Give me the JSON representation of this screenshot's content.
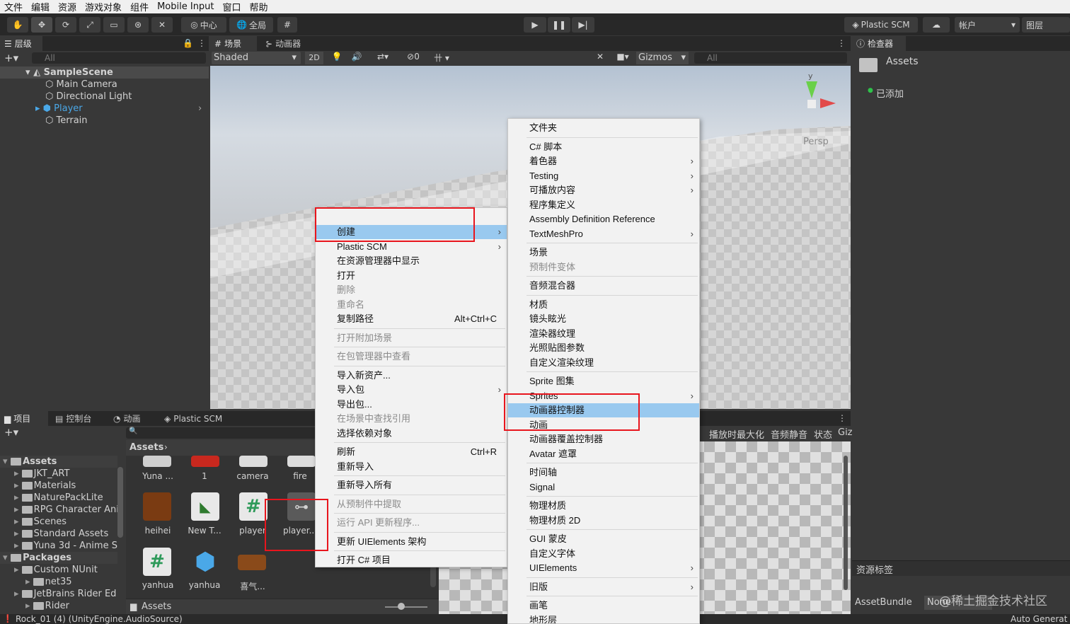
{
  "menubar": [
    "文件",
    "编辑",
    "资源",
    "游戏对象",
    "组件",
    "Mobile Input",
    "窗口",
    "帮助"
  ],
  "toolbar": {
    "pivot": "中心",
    "global": "全局",
    "plastic": "Plastic SCM",
    "account": "帐户",
    "layers": "图层"
  },
  "hierarchy": {
    "tab": "层级",
    "search_placeholder": "All",
    "scene": "SampleScene",
    "items": [
      "Main Camera",
      "Directional Light",
      "Player",
      "Terrain"
    ]
  },
  "scene_view": {
    "tab_scene": "场景",
    "tab_animator": "动画器",
    "shading": "Shaded",
    "mode_2d": "2D",
    "hidden_count": "0",
    "gizmos": "Gizmos",
    "search_placeholder": "All",
    "axis_y": "y",
    "persp": "Persp"
  },
  "inspector": {
    "tab": "检查器",
    "title": "Assets",
    "added": "已添加",
    "asset_labels": "资源标签",
    "assetbundle": "AssetBundle",
    "none": "None",
    "auto_generate": "Auto Generat"
  },
  "bottom_tabs": [
    "项目",
    "控制台",
    "动画",
    "Plastic SCM"
  ],
  "game_toolbar": [
    "播放时最大化",
    "音频静音",
    "状态",
    "Giz"
  ],
  "project": {
    "breadcrumb": "Assets",
    "tree": [
      {
        "label": "Assets",
        "level": 0,
        "bold": true
      },
      {
        "label": "JKT_ART",
        "level": 1
      },
      {
        "label": "Materials",
        "level": 1
      },
      {
        "label": "NaturePackLite",
        "level": 1
      },
      {
        "label": "RPG Character Ani",
        "level": 1
      },
      {
        "label": "Scenes",
        "level": 1
      },
      {
        "label": "Standard Assets",
        "level": 1
      },
      {
        "label": "Yuna 3d - Anime S",
        "level": 1
      },
      {
        "label": "Packages",
        "level": 0,
        "bold": true
      },
      {
        "label": "Custom NUnit",
        "level": 1
      },
      {
        "label": "net35",
        "level": 2
      },
      {
        "label": "JetBrains Rider Ed",
        "level": 1
      },
      {
        "label": "Rider",
        "level": 2
      }
    ],
    "assets_row1": [
      "Yuna ...",
      "1",
      "camera",
      "fire"
    ],
    "assets_row2": [
      "heihei",
      "New T...",
      "player",
      "player..."
    ],
    "assets_row3": [
      "yanhua",
      "yanhua",
      "喜气..."
    ],
    "footer_path": "Assets"
  },
  "context_menu": [
    {
      "label": "创建",
      "submenu": true,
      "highlight": true
    },
    {
      "label": "Plastic SCM",
      "submenu": true
    },
    {
      "label": "在资源管理器中显示"
    },
    {
      "label": "打开"
    },
    {
      "label": "删除",
      "disabled": true
    },
    {
      "label": "重命名",
      "disabled": true
    },
    {
      "label": "复制路径",
      "shortcut": "Alt+Ctrl+C"
    },
    {
      "sep": true
    },
    {
      "label": "打开附加场景",
      "disabled": true
    },
    {
      "sep": true
    },
    {
      "label": "在包管理器中查看",
      "disabled": true
    },
    {
      "sep": true
    },
    {
      "label": "导入新资产..."
    },
    {
      "label": "导入包",
      "submenu": true
    },
    {
      "label": "导出包..."
    },
    {
      "label": "在场景中查找引用",
      "disabled": true
    },
    {
      "label": "选择依赖对象"
    },
    {
      "sep": true
    },
    {
      "label": "刷新",
      "shortcut": "Ctrl+R"
    },
    {
      "label": "重新导入"
    },
    {
      "sep": true
    },
    {
      "label": "重新导入所有"
    },
    {
      "sep": true
    },
    {
      "label": "从预制件中提取",
      "disabled": true
    },
    {
      "sep": true
    },
    {
      "label": "运行 API 更新程序...",
      "disabled": true
    },
    {
      "sep": true
    },
    {
      "label": "更新 UIElements 架构"
    },
    {
      "sep": true
    },
    {
      "label": "打开 C# 项目"
    }
  ],
  "submenu": [
    {
      "label": "文件夹"
    },
    {
      "sep": true
    },
    {
      "label": "C# 脚本"
    },
    {
      "label": "着色器",
      "submenu": true
    },
    {
      "label": "Testing",
      "submenu": true
    },
    {
      "label": "可播放内容",
      "submenu": true
    },
    {
      "label": "程序集定义"
    },
    {
      "label": "Assembly Definition Reference"
    },
    {
      "label": "TextMeshPro",
      "submenu": true
    },
    {
      "sep": true
    },
    {
      "label": "场景"
    },
    {
      "label": "预制件变体",
      "disabled": true
    },
    {
      "sep": true
    },
    {
      "label": "音频混合器"
    },
    {
      "sep": true
    },
    {
      "label": "材质"
    },
    {
      "label": "镜头眩光"
    },
    {
      "label": "渲染器纹理"
    },
    {
      "label": "光照贴图参数"
    },
    {
      "label": "自定义渲染纹理"
    },
    {
      "sep": true
    },
    {
      "label": "Sprite 图集"
    },
    {
      "label": "Sprites",
      "submenu": true
    },
    {
      "label": "动画器控制器",
      "highlight": true
    },
    {
      "label": "动画"
    },
    {
      "label": "动画器覆盖控制器"
    },
    {
      "label": "Avatar 遮罩"
    },
    {
      "sep": true
    },
    {
      "label": "时间轴"
    },
    {
      "label": "Signal"
    },
    {
      "sep": true
    },
    {
      "label": "物理材质"
    },
    {
      "label": "物理材质 2D"
    },
    {
      "sep": true
    },
    {
      "label": "GUI 蒙皮"
    },
    {
      "label": "自定义字体"
    },
    {
      "label": "UIElements",
      "submenu": true
    },
    {
      "sep": true
    },
    {
      "label": "旧版",
      "submenu": true
    },
    {
      "sep": true
    },
    {
      "label": "画笔"
    },
    {
      "label": "地形层"
    }
  ],
  "statusbar": {
    "message": "Rock_01 (4) (UnityEngine.AudioSource)"
  },
  "watermark": "@稀土掘金技术社区",
  "colors": {
    "highlight": "#99c9ef",
    "annotation": "#e8151d",
    "player_blue": "#4aa8e8",
    "accent": "#2ec24a"
  }
}
